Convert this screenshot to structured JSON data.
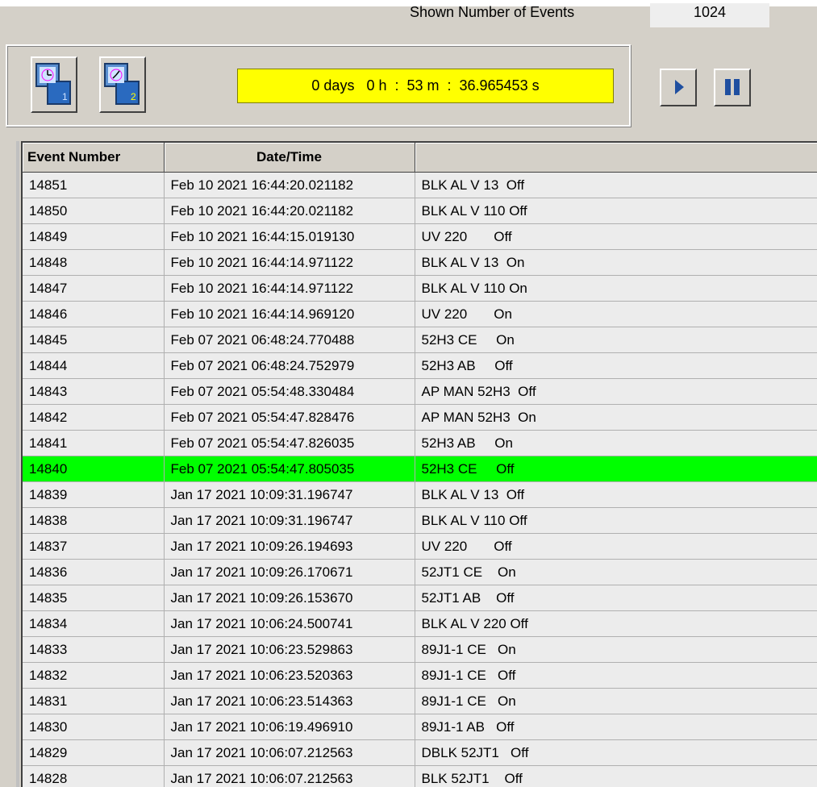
{
  "header": {
    "shown_events_label": "Shown Number of Events",
    "shown_events_value": "1024"
  },
  "toolbar": {
    "tool1_badge": "1",
    "tool2_badge": "2",
    "elapsed": "0 days   0 h  :  53 m  :  36.965453 s"
  },
  "table": {
    "columns": [
      "Event Number",
      "Date/Time",
      ""
    ],
    "selected_event": "14840",
    "selected_color": "#00ff00",
    "rows": [
      {
        "event": "14851",
        "datetime": "Feb 10 2021 16:44:20.021182",
        "description": "BLK AL V 13  Off"
      },
      {
        "event": "14850",
        "datetime": "Feb 10 2021 16:44:20.021182",
        "description": "BLK AL V 110 Off"
      },
      {
        "event": "14849",
        "datetime": "Feb 10 2021 16:44:15.019130",
        "description": "UV 220       Off"
      },
      {
        "event": "14848",
        "datetime": "Feb 10 2021 16:44:14.971122",
        "description": "BLK AL V 13  On"
      },
      {
        "event": "14847",
        "datetime": "Feb 10 2021 16:44:14.971122",
        "description": "BLK AL V 110 On"
      },
      {
        "event": "14846",
        "datetime": "Feb 10 2021 16:44:14.969120",
        "description": "UV 220       On"
      },
      {
        "event": "14845",
        "datetime": "Feb 07 2021 06:48:24.770488",
        "description": "52H3 CE     On"
      },
      {
        "event": "14844",
        "datetime": "Feb 07 2021 06:48:24.752979",
        "description": "52H3 AB     Off"
      },
      {
        "event": "14843",
        "datetime": "Feb 07 2021 05:54:48.330484",
        "description": "AP MAN 52H3  Off"
      },
      {
        "event": "14842",
        "datetime": "Feb 07 2021 05:54:47.828476",
        "description": "AP MAN 52H3  On"
      },
      {
        "event": "14841",
        "datetime": "Feb 07 2021 05:54:47.826035",
        "description": "52H3 AB     On"
      },
      {
        "event": "14840",
        "datetime": "Feb 07 2021 05:54:47.805035",
        "description": "52H3 CE     Off"
      },
      {
        "event": "14839",
        "datetime": "Jan 17 2021 10:09:31.196747",
        "description": "BLK AL V 13  Off"
      },
      {
        "event": "14838",
        "datetime": "Jan 17 2021 10:09:31.196747",
        "description": "BLK AL V 110 Off"
      },
      {
        "event": "14837",
        "datetime": "Jan 17 2021 10:09:26.194693",
        "description": "UV 220       Off"
      },
      {
        "event": "14836",
        "datetime": "Jan 17 2021 10:09:26.170671",
        "description": "52JT1 CE    On"
      },
      {
        "event": "14835",
        "datetime": "Jan 17 2021 10:09:26.153670",
        "description": "52JT1 AB    Off"
      },
      {
        "event": "14834",
        "datetime": "Jan 17 2021 10:06:24.500741",
        "description": "BLK AL V 220 Off"
      },
      {
        "event": "14833",
        "datetime": "Jan 17 2021 10:06:23.529863",
        "description": "89J1-1 CE   On"
      },
      {
        "event": "14832",
        "datetime": "Jan 17 2021 10:06:23.520363",
        "description": "89J1-1 CE   Off"
      },
      {
        "event": "14831",
        "datetime": "Jan 17 2021 10:06:23.514363",
        "description": "89J1-1 CE   On"
      },
      {
        "event": "14830",
        "datetime": "Jan 17 2021 10:06:19.496910",
        "description": "89J1-1 AB   Off"
      },
      {
        "event": "14829",
        "datetime": "Jan 17 2021 10:06:07.212563",
        "description": "DBLK 52JT1   Off"
      },
      {
        "event": "14828",
        "datetime": "Jan 17 2021 10:06:07.212563",
        "description": "BLK 52JT1    Off"
      }
    ]
  }
}
